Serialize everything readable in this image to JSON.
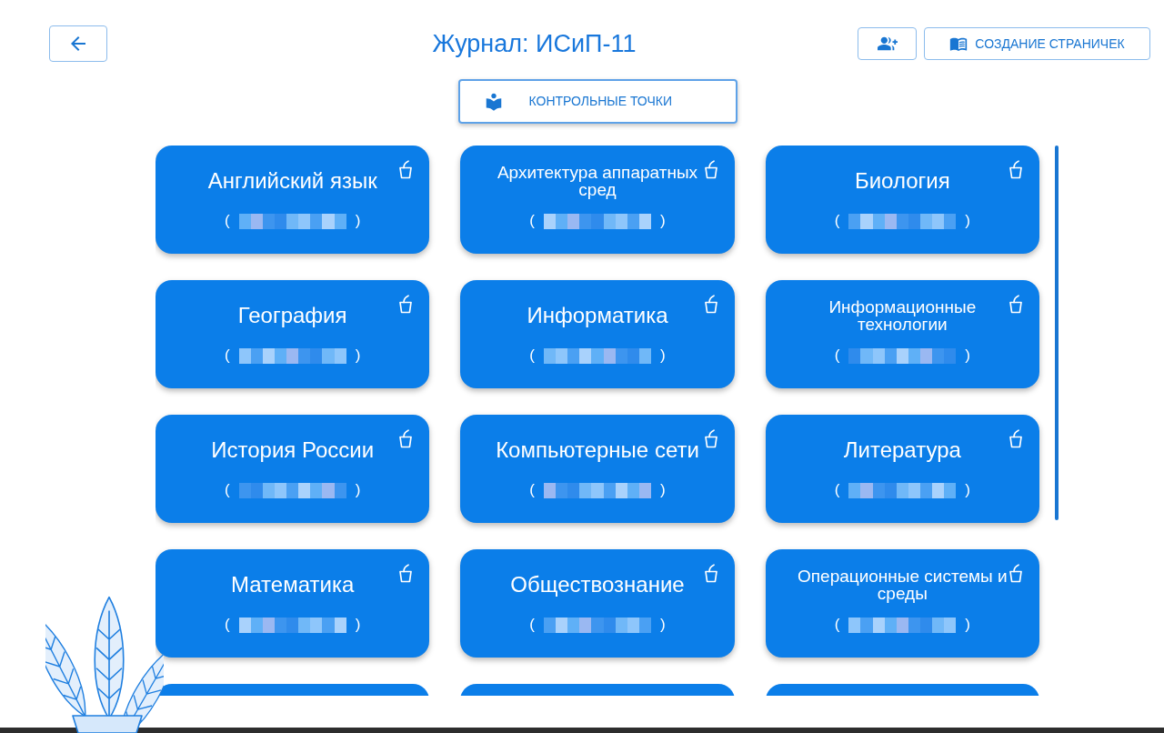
{
  "header": {
    "title": "Журнал: ИСиП-11",
    "create_pages_button": "СОЗДАНИЕ СТРАНИЧЕК"
  },
  "checkpoints_button": "КОНТРОЛЬНЫЕ ТОЧКИ",
  "subjects": [
    {
      "kind": "subject",
      "title": "Английский язык",
      "subtitle": {
        "open": "(",
        "close": ")"
      }
    },
    {
      "kind": "subject",
      "title": "Архитектура аппаратных сред",
      "subtitle": {
        "open": "(",
        "close": ")"
      }
    },
    {
      "kind": "subject",
      "title": "Биология",
      "subtitle": {
        "open": "(",
        "close": ")"
      }
    },
    {
      "kind": "subject",
      "title": "География",
      "subtitle": {
        "open": "(",
        "close": ")"
      }
    },
    {
      "kind": "subject",
      "title": "Информатика",
      "subtitle": {
        "open": "(",
        "close": ")"
      }
    },
    {
      "kind": "subject",
      "title": "Информационные технологии",
      "subtitle": {
        "open": "(",
        "close": ")"
      }
    },
    {
      "kind": "subject",
      "title": "История России",
      "subtitle": {
        "open": "(",
        "close": ")"
      }
    },
    {
      "kind": "subject",
      "title": "Компьютерные сети",
      "subtitle": {
        "open": "(",
        "close": ")"
      }
    },
    {
      "kind": "subject",
      "title": "Литература",
      "subtitle": {
        "open": "(",
        "close": ")"
      }
    },
    {
      "kind": "subject",
      "title": "Математика",
      "subtitle": {
        "open": "(",
        "close": ")"
      }
    },
    {
      "kind": "subject",
      "title": "Обществознание",
      "subtitle": {
        "open": "(",
        "close": ")"
      }
    },
    {
      "kind": "subject",
      "title": "Операционные системы и среды",
      "subtitle": {
        "open": "(",
        "close": ")"
      }
    },
    {
      "kind": "cut"
    },
    {
      "kind": "cut"
    },
    {
      "kind": "cut"
    }
  ]
}
